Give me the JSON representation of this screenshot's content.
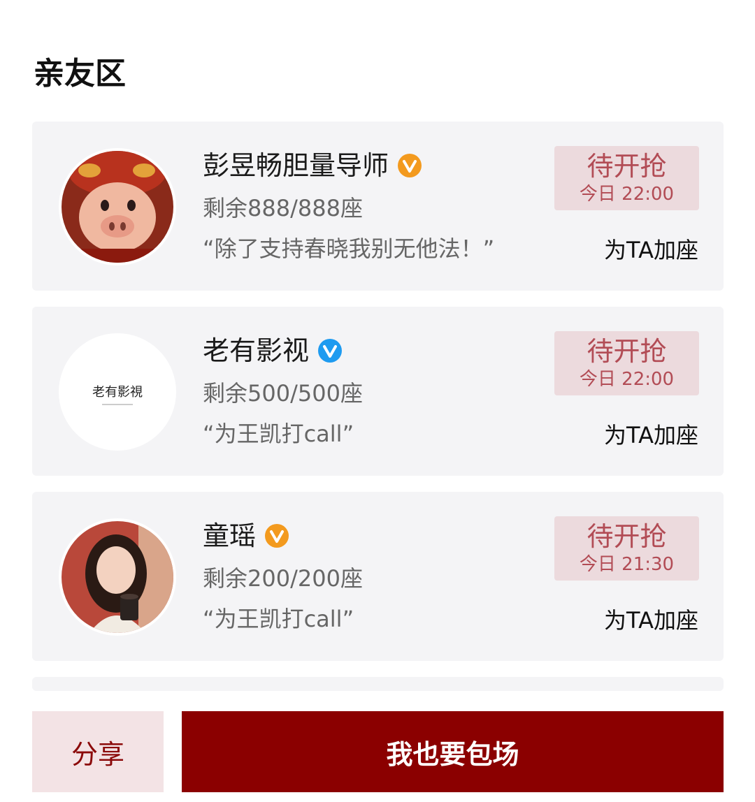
{
  "section": {
    "title": "亲友区"
  },
  "colors": {
    "accent": "#8b0000",
    "grab_bg": "#ecdadd",
    "grab_text": "#b24c55",
    "card_bg": "#f4f4f6"
  },
  "items": [
    {
      "name": "彭昱畅胆量导师",
      "badge": "orange-verified-icon",
      "seats": "剩余888/888座",
      "quote": "“除了支持春晓我别无他法！”",
      "grab_label": "待开抢",
      "grab_time": "今日 22:00",
      "add_label": "为TA加座"
    },
    {
      "name": "老有影视",
      "badge": "blue-verified-icon",
      "seats": "剩余500/500座",
      "quote": "“为王凯打call”",
      "grab_label": "待开抢",
      "grab_time": "今日 22:00",
      "add_label": "为TA加座",
      "logo_text": "老有影視"
    },
    {
      "name": "童瑶",
      "badge": "orange-verified-icon",
      "seats": "剩余200/200座",
      "quote": "“为王凯打call”",
      "grab_label": "待开抢",
      "grab_time": "今日 21:30",
      "add_label": "为TA加座"
    }
  ],
  "bottom": {
    "share_label": "分享",
    "book_label": "我也要包场"
  }
}
